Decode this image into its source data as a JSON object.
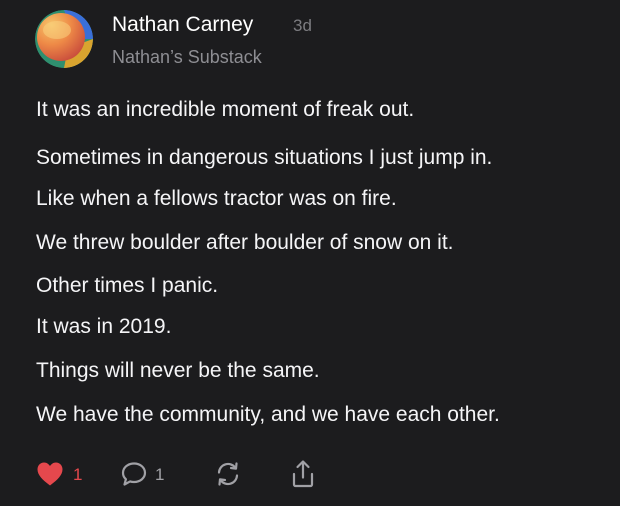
{
  "post": {
    "author": "Nathan Carney",
    "time_ago": "3d",
    "publication": "Nathan’s Substack",
    "body": [
      "It was an incredible moment of freak out.",
      "Sometimes in dangerous situations I just jump in.",
      "Like when a fellows tractor was on fire.",
      "We threw boulder after boulder of snow on it.",
      "Other times I panic.",
      "It was in 2019.",
      "Things will never be the same.",
      "We have the community, and we have each other."
    ]
  },
  "actions": {
    "like": {
      "icon": "heart-icon",
      "count": "1",
      "liked": true,
      "color": "#e5484d"
    },
    "comment": {
      "icon": "comment-icon",
      "count": "1"
    },
    "restack": {
      "icon": "restack-icon"
    },
    "share": {
      "icon": "share-icon"
    }
  },
  "colors": {
    "background": "#1c1c1e",
    "text": "#f5f5f7",
    "muted": "#8e8e93",
    "accent_like": "#e5484d"
  }
}
